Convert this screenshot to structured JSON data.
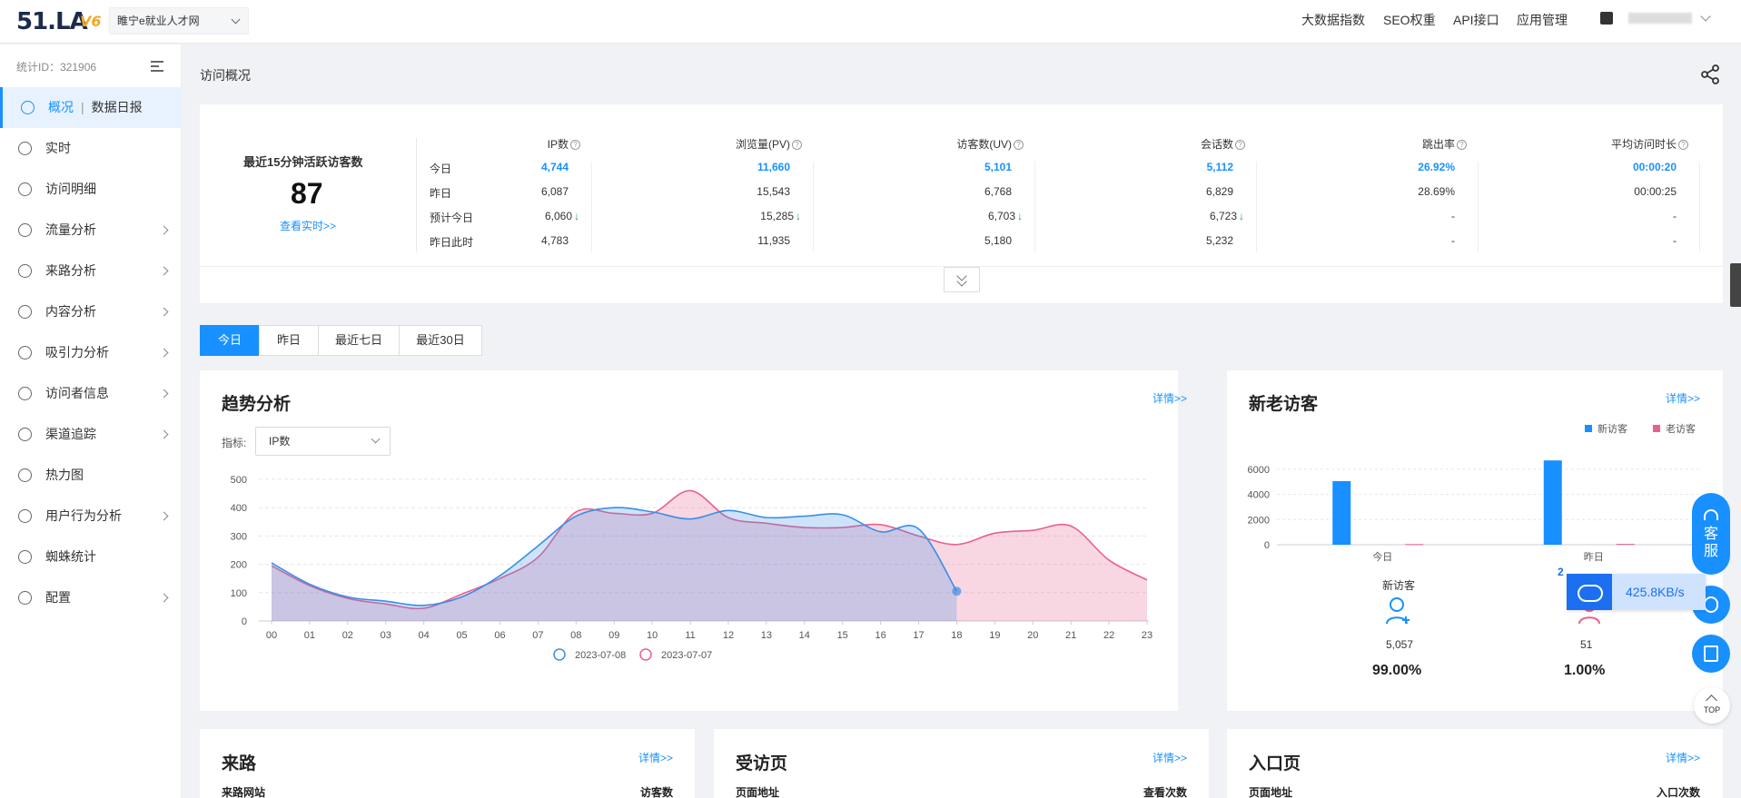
{
  "header": {
    "logo": "51.LA",
    "logo_version": "V6",
    "site_name": "睢宁e就业人才网",
    "nav": [
      "大数据指数",
      "SEO权重",
      "API接口",
      "应用管理"
    ]
  },
  "sidebar": {
    "stat_id": "统计ID：321906",
    "items": [
      {
        "label": "概况",
        "sub": "数据日报",
        "icon": "dashboard-icon"
      },
      {
        "label": "实时",
        "icon": "clock-icon"
      },
      {
        "label": "访问明细",
        "icon": "search-doc-icon"
      },
      {
        "label": "流量分析",
        "icon": "wave-icon"
      },
      {
        "label": "来路分析",
        "icon": "source-icon"
      },
      {
        "label": "内容分析",
        "icon": "document-icon"
      },
      {
        "label": "吸引力分析",
        "icon": "pie-icon"
      },
      {
        "label": "访问者信息",
        "icon": "mail-icon"
      },
      {
        "label": "渠道追踪",
        "icon": "target-icon"
      },
      {
        "label": "热力图",
        "icon": "heat-icon"
      },
      {
        "label": "用户行为分析",
        "icon": "users-icon"
      },
      {
        "label": "蜘蛛统计",
        "icon": "spider-icon"
      },
      {
        "label": "配置",
        "icon": "gear-icon"
      }
    ]
  },
  "breadcrumb": "访问概况",
  "active_visitors": {
    "title": "最近15分钟活跃访客数",
    "value": "87",
    "link": "查看实时>>"
  },
  "stats": {
    "row_labels": [
      "今日",
      "昨日",
      "预计今日",
      "昨日此时"
    ],
    "columns": [
      {
        "head": "IP数",
        "values": [
          "4,744",
          "6,087",
          "6,060",
          "4,783"
        ]
      },
      {
        "head": "浏览量(PV)",
        "values": [
          "11,660",
          "15,543",
          "15,285",
          "11,935"
        ]
      },
      {
        "head": "访客数(UV)",
        "values": [
          "5,101",
          "6,768",
          "6,703",
          "5,180"
        ]
      },
      {
        "head": "会话数",
        "values": [
          "5,112",
          "6,829",
          "6,723",
          "5,232"
        ]
      },
      {
        "head": "跳出率",
        "values": [
          "26.92%",
          "28.69%",
          "-",
          "-"
        ]
      },
      {
        "head": "平均访问时长",
        "values": [
          "00:00:20",
          "00:00:25",
          "-",
          "-"
        ]
      }
    ],
    "help_mark": "?",
    "down_arrow": "↓"
  },
  "tabs": [
    "今日",
    "昨日",
    "最近七日",
    "最近30日"
  ],
  "trend": {
    "title": "趋势分析",
    "detail": "详情>>",
    "metric_label": "指标:",
    "metric_value": "IP数"
  },
  "new_old": {
    "title": "新老访客",
    "detail": "详情>>",
    "new_label": "新访客",
    "new_count": "5,057",
    "new_pct": "99.00%",
    "old_count": "51",
    "old_pct": "1.00%"
  },
  "bottom_panels": [
    {
      "title": "来路",
      "detail": "详情>>",
      "col1": "来路网站",
      "col2": "访客数"
    },
    {
      "title": "受访页",
      "detail": "详情>>",
      "col1": "页面地址",
      "col2": "查看次数"
    },
    {
      "title": "入口页",
      "detail": "详情>>",
      "col1": "页面地址",
      "col2": "入口次数"
    }
  ],
  "float": {
    "service": "客服",
    "top": "TOP",
    "speed_badge": "2",
    "speed": "425.8KB/s"
  },
  "colors": {
    "accent": "#1890ff",
    "today": "#3a8ee6",
    "yesterday": "#e8618c"
  },
  "chart_data": [
    {
      "type": "area",
      "x": [
        "00",
        "01",
        "02",
        "03",
        "04",
        "05",
        "06",
        "07",
        "08",
        "09",
        "10",
        "11",
        "12",
        "13",
        "14",
        "15",
        "16",
        "17",
        "18",
        "19",
        "20",
        "21",
        "22",
        "23"
      ],
      "ylim": [
        0,
        500
      ],
      "yticks": [
        0,
        100,
        200,
        300,
        400,
        500
      ],
      "grid": true,
      "legend_position": "bottom",
      "series": [
        {
          "name": "2023-07-08",
          "color": "#3a8ee6",
          "values": [
            205,
            130,
            85,
            70,
            55,
            85,
            160,
            265,
            370,
            400,
            385,
            360,
            390,
            365,
            370,
            375,
            315,
            325,
            105
          ]
        },
        {
          "name": "2023-07-07",
          "color": "#e8618c",
          "values": [
            195,
            125,
            80,
            60,
            45,
            95,
            150,
            225,
            385,
            380,
            380,
            460,
            365,
            345,
            330,
            330,
            340,
            300,
            270,
            310,
            320,
            335,
            215,
            145
          ]
        }
      ]
    },
    {
      "type": "bar",
      "categories": [
        "今日",
        "昨日"
      ],
      "ylim": [
        0,
        7000
      ],
      "yticks": [
        0,
        2000,
        4000,
        6000
      ],
      "grid": true,
      "legend_position": "top-right",
      "series": [
        {
          "name": "新访客",
          "color": "#1890ff",
          "values": [
            5057,
            6700
          ]
        },
        {
          "name": "老访客",
          "color": "#e8618c",
          "values": [
            51,
            68
          ]
        }
      ]
    }
  ]
}
